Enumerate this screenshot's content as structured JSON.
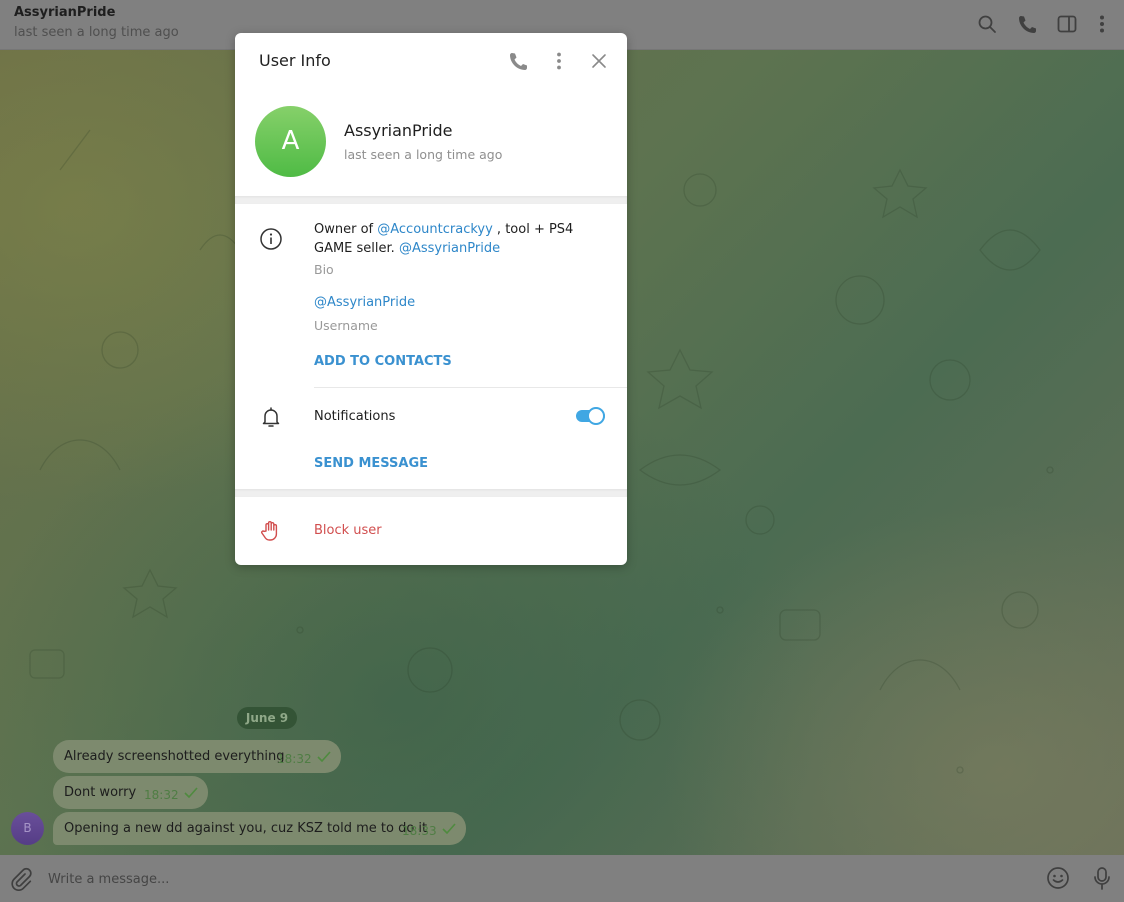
{
  "header": {
    "title": "AssyrianPride",
    "status": "last seen a long time ago",
    "icons": [
      "search-icon",
      "phone-icon",
      "sidebar-toggle-icon",
      "more-vertical-icon"
    ]
  },
  "chat": {
    "date_separator": "June 9",
    "sender_avatar_letter": "B",
    "messages": [
      {
        "text": "Already screenshotted everything",
        "time": "18:32",
        "status": "sent"
      },
      {
        "text": "Dont worry",
        "time": "18:32",
        "status": "sent"
      },
      {
        "text": "Opening a new dd against you, cuz KSZ told me to do it",
        "time": "18:33",
        "status": "sent"
      }
    ]
  },
  "composer": {
    "placeholder": "Write a message...",
    "icons": [
      "attach-icon",
      "emoji-icon",
      "microphone-icon"
    ]
  },
  "modal": {
    "title": "User Info",
    "header_icons": [
      "phone-icon",
      "more-vertical-icon",
      "close-icon"
    ],
    "avatar_letter": "A",
    "avatar_color": "#5ec150",
    "name": "AssyrianPride",
    "status": "last seen a long time ago",
    "bio": {
      "prefix": "Owner of ",
      "mention1": "@Accountcrackyy",
      "middle": " , tool + PS4 GAME seller. ",
      "mention2": "@AssyrianPride",
      "label": "Bio"
    },
    "username": {
      "value": "@AssyrianPride",
      "label": "Username"
    },
    "add_to_contacts": "ADD TO CONTACTS",
    "notifications": {
      "label": "Notifications",
      "enabled": true
    },
    "send_message": "SEND MESSAGE",
    "block_user": "Block user",
    "accent_color": "#3a91d0",
    "danger_color": "#d14e4e"
  }
}
